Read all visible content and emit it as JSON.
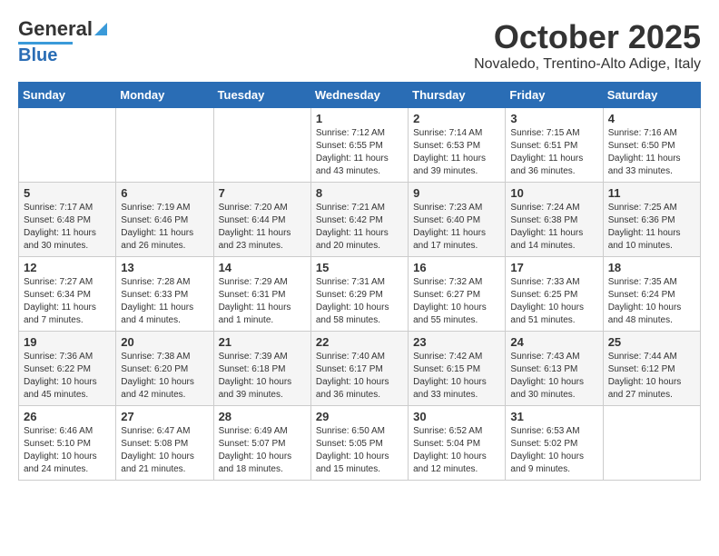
{
  "header": {
    "logo_line1": "General",
    "logo_line2": "Blue",
    "month": "October 2025",
    "location": "Novaledo, Trentino-Alto Adige, Italy"
  },
  "days_of_week": [
    "Sunday",
    "Monday",
    "Tuesday",
    "Wednesday",
    "Thursday",
    "Friday",
    "Saturday"
  ],
  "weeks": [
    [
      {
        "day": "",
        "info": ""
      },
      {
        "day": "",
        "info": ""
      },
      {
        "day": "",
        "info": ""
      },
      {
        "day": "1",
        "info": "Sunrise: 7:12 AM\nSunset: 6:55 PM\nDaylight: 11 hours\nand 43 minutes."
      },
      {
        "day": "2",
        "info": "Sunrise: 7:14 AM\nSunset: 6:53 PM\nDaylight: 11 hours\nand 39 minutes."
      },
      {
        "day": "3",
        "info": "Sunrise: 7:15 AM\nSunset: 6:51 PM\nDaylight: 11 hours\nand 36 minutes."
      },
      {
        "day": "4",
        "info": "Sunrise: 7:16 AM\nSunset: 6:50 PM\nDaylight: 11 hours\nand 33 minutes."
      }
    ],
    [
      {
        "day": "5",
        "info": "Sunrise: 7:17 AM\nSunset: 6:48 PM\nDaylight: 11 hours\nand 30 minutes."
      },
      {
        "day": "6",
        "info": "Sunrise: 7:19 AM\nSunset: 6:46 PM\nDaylight: 11 hours\nand 26 minutes."
      },
      {
        "day": "7",
        "info": "Sunrise: 7:20 AM\nSunset: 6:44 PM\nDaylight: 11 hours\nand 23 minutes."
      },
      {
        "day": "8",
        "info": "Sunrise: 7:21 AM\nSunset: 6:42 PM\nDaylight: 11 hours\nand 20 minutes."
      },
      {
        "day": "9",
        "info": "Sunrise: 7:23 AM\nSunset: 6:40 PM\nDaylight: 11 hours\nand 17 minutes."
      },
      {
        "day": "10",
        "info": "Sunrise: 7:24 AM\nSunset: 6:38 PM\nDaylight: 11 hours\nand 14 minutes."
      },
      {
        "day": "11",
        "info": "Sunrise: 7:25 AM\nSunset: 6:36 PM\nDaylight: 11 hours\nand 10 minutes."
      }
    ],
    [
      {
        "day": "12",
        "info": "Sunrise: 7:27 AM\nSunset: 6:34 PM\nDaylight: 11 hours\nand 7 minutes."
      },
      {
        "day": "13",
        "info": "Sunrise: 7:28 AM\nSunset: 6:33 PM\nDaylight: 11 hours\nand 4 minutes."
      },
      {
        "day": "14",
        "info": "Sunrise: 7:29 AM\nSunset: 6:31 PM\nDaylight: 11 hours\nand 1 minute."
      },
      {
        "day": "15",
        "info": "Sunrise: 7:31 AM\nSunset: 6:29 PM\nDaylight: 10 hours\nand 58 minutes."
      },
      {
        "day": "16",
        "info": "Sunrise: 7:32 AM\nSunset: 6:27 PM\nDaylight: 10 hours\nand 55 minutes."
      },
      {
        "day": "17",
        "info": "Sunrise: 7:33 AM\nSunset: 6:25 PM\nDaylight: 10 hours\nand 51 minutes."
      },
      {
        "day": "18",
        "info": "Sunrise: 7:35 AM\nSunset: 6:24 PM\nDaylight: 10 hours\nand 48 minutes."
      }
    ],
    [
      {
        "day": "19",
        "info": "Sunrise: 7:36 AM\nSunset: 6:22 PM\nDaylight: 10 hours\nand 45 minutes."
      },
      {
        "day": "20",
        "info": "Sunrise: 7:38 AM\nSunset: 6:20 PM\nDaylight: 10 hours\nand 42 minutes."
      },
      {
        "day": "21",
        "info": "Sunrise: 7:39 AM\nSunset: 6:18 PM\nDaylight: 10 hours\nand 39 minutes."
      },
      {
        "day": "22",
        "info": "Sunrise: 7:40 AM\nSunset: 6:17 PM\nDaylight: 10 hours\nand 36 minutes."
      },
      {
        "day": "23",
        "info": "Sunrise: 7:42 AM\nSunset: 6:15 PM\nDaylight: 10 hours\nand 33 minutes."
      },
      {
        "day": "24",
        "info": "Sunrise: 7:43 AM\nSunset: 6:13 PM\nDaylight: 10 hours\nand 30 minutes."
      },
      {
        "day": "25",
        "info": "Sunrise: 7:44 AM\nSunset: 6:12 PM\nDaylight: 10 hours\nand 27 minutes."
      }
    ],
    [
      {
        "day": "26",
        "info": "Sunrise: 6:46 AM\nSunset: 5:10 PM\nDaylight: 10 hours\nand 24 minutes."
      },
      {
        "day": "27",
        "info": "Sunrise: 6:47 AM\nSunset: 5:08 PM\nDaylight: 10 hours\nand 21 minutes."
      },
      {
        "day": "28",
        "info": "Sunrise: 6:49 AM\nSunset: 5:07 PM\nDaylight: 10 hours\nand 18 minutes."
      },
      {
        "day": "29",
        "info": "Sunrise: 6:50 AM\nSunset: 5:05 PM\nDaylight: 10 hours\nand 15 minutes."
      },
      {
        "day": "30",
        "info": "Sunrise: 6:52 AM\nSunset: 5:04 PM\nDaylight: 10 hours\nand 12 minutes."
      },
      {
        "day": "31",
        "info": "Sunrise: 6:53 AM\nSunset: 5:02 PM\nDaylight: 10 hours\nand 9 minutes."
      },
      {
        "day": "",
        "info": ""
      }
    ]
  ]
}
